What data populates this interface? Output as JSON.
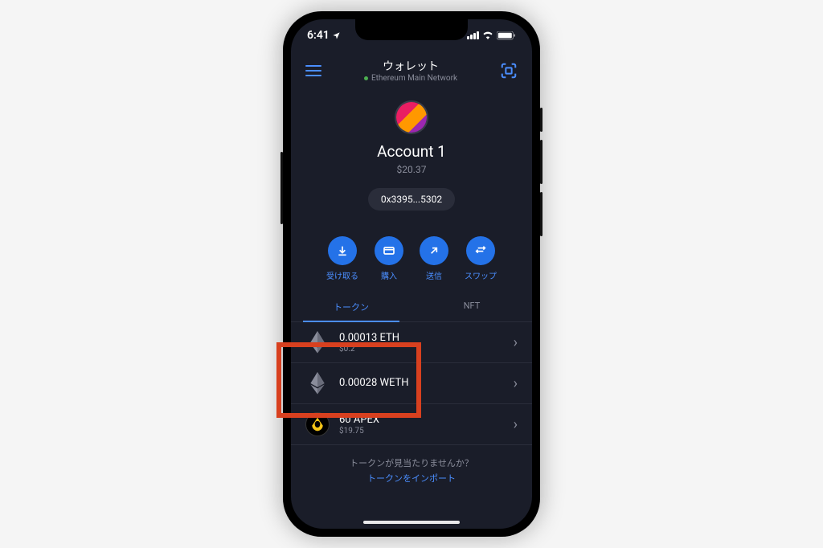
{
  "status_bar": {
    "time": "6:41"
  },
  "header": {
    "title": "ウォレット",
    "network": "Ethereum Main Network"
  },
  "account": {
    "name": "Account 1",
    "balance": "$20.37",
    "address": "0x3395...5302"
  },
  "actions": {
    "receive": "受け取る",
    "buy": "購入",
    "send": "送信",
    "swap": "スワップ"
  },
  "tabs": {
    "tokens": "トークン",
    "nft": "NFT"
  },
  "tokens": [
    {
      "amount": "0.00013 ETH",
      "value": "$0.2",
      "symbol": "ETH"
    },
    {
      "amount": "0.00028 WETH",
      "value": "",
      "symbol": "WETH"
    },
    {
      "amount": "60 APEX",
      "value": "$19.75",
      "symbol": "APEX"
    }
  ],
  "footer": {
    "not_found": "トークンが見当たりませんか？",
    "import_link": "トークンをインポート"
  }
}
